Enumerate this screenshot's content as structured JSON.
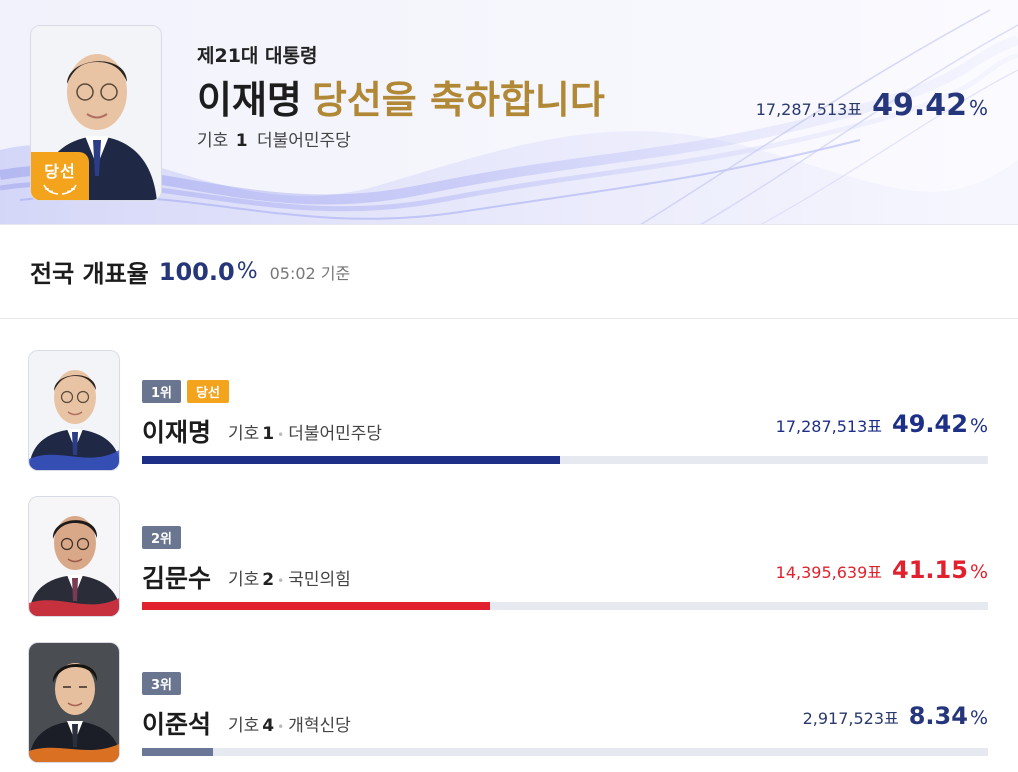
{
  "banner": {
    "subtitle": "제21대 대통령",
    "name": "이재명",
    "congrats": "당선을 축하합니다",
    "symbol_label": "기호",
    "symbol_number": "1",
    "party": "더불어민주당",
    "votes": "17,287,513표",
    "percent": "49.42",
    "percent_unit": "%",
    "badge_label": "당선",
    "badge_icon": "laurel-wreath-icon"
  },
  "count_rate": {
    "label": "전국 개표율",
    "value": "100.0",
    "unit": "%",
    "time": "05:02 기준"
  },
  "candidates": [
    {
      "rank": "1위",
      "elected_label": "당선",
      "name": "이재명",
      "symbol_label": "기호",
      "symbol_number": "1",
      "party": "더불어민주당",
      "votes": "17,287,513표",
      "percent": "49.42",
      "percent_unit": "%",
      "share": 0.4942,
      "color": "#1e2f88"
    },
    {
      "rank": "2위",
      "name": "김문수",
      "symbol_label": "기호",
      "symbol_number": "2",
      "party": "국민의힘",
      "votes": "14,395,639표",
      "percent": "41.15",
      "percent_unit": "%",
      "share": 0.4115,
      "color": "#e1222e"
    },
    {
      "rank": "3위",
      "name": "이준석",
      "symbol_label": "기호",
      "symbol_number": "4",
      "party": "개혁신당",
      "votes": "2,917,523표",
      "percent": "8.34",
      "percent_unit": "%",
      "share": 0.0834,
      "color": "#6b7796",
      "vote_text_color": "#2a3a6b",
      "percent_color": "#26367a"
    }
  ],
  "colors": {
    "accent_gold": "#b08836",
    "badge_orange": "#f4a41c",
    "navy": "#26367a"
  }
}
